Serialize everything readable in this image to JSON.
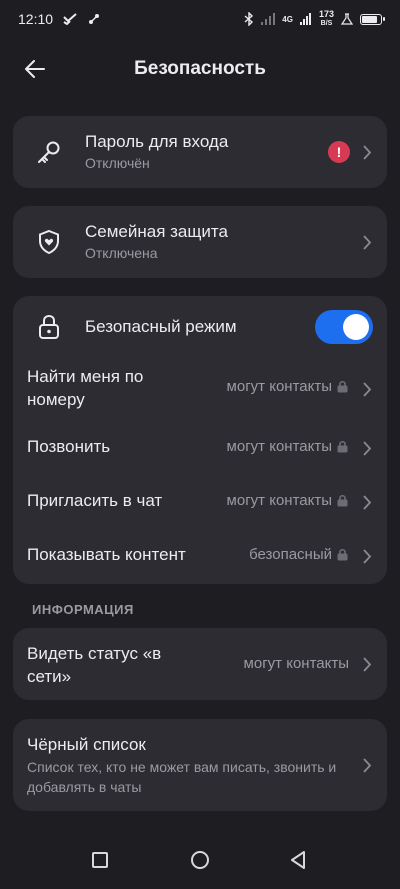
{
  "status_bar": {
    "time": "12:10",
    "network": "4G",
    "speed_value": "173",
    "speed_unit": "B/S",
    "battery_level": 0.75
  },
  "header": {
    "title": "Безопасность"
  },
  "password_card": {
    "title": "Пароль для входа",
    "subtitle": "Отключён",
    "alert": "!"
  },
  "family_card": {
    "title": "Семейная защита",
    "subtitle": "Отключена"
  },
  "safe_mode_card": {
    "title": "Безопасный режим",
    "toggle_on": true,
    "rows": [
      {
        "label": "Найти меня по номеру",
        "value": "могут контакты"
      },
      {
        "label": "Позвонить",
        "value": "могут контакты"
      },
      {
        "label": "Пригласить в чат",
        "value": "могут контакты"
      },
      {
        "label": "Показывать контент",
        "value": "безопасный"
      }
    ]
  },
  "info_section": {
    "label": "ИНФОРМАЦИЯ",
    "status_row": {
      "label": "Видеть статус «в сети»",
      "value": "могут контакты"
    }
  },
  "blacklist_card": {
    "title": "Чёрный список",
    "subtitle": "Список тех, кто не может вам писать, звонить и добавлять в чаты"
  },
  "colors": {
    "accent": "#1e6ef0",
    "alert": "#d63a55",
    "card": "#2c2c32",
    "background": "#1d1d22"
  }
}
